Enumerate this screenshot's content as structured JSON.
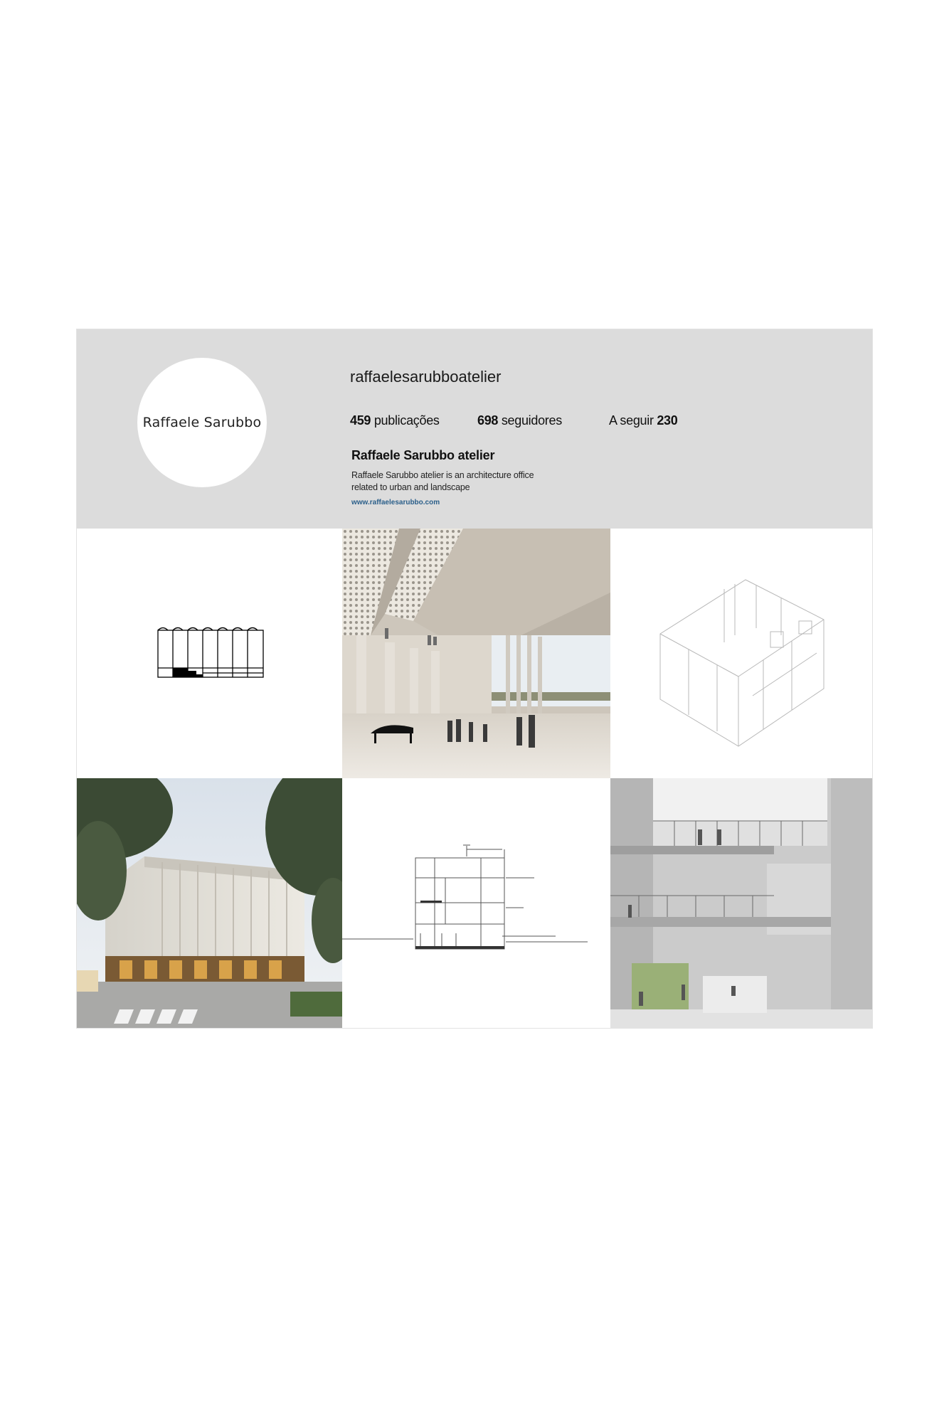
{
  "profile": {
    "avatar_text": "Raffaele Sarubbo",
    "username": "raffaelesarubboatelier",
    "stats": {
      "posts_count": "459",
      "posts_label": "publicações",
      "followers_count": "698",
      "followers_label": "seguidores",
      "following_label": "A seguir",
      "following_count": "230"
    },
    "full_name": "Raffaele Sarubbo atelier",
    "bio": "Raffaele Sarubbo atelier is an architecture office related to urban and landscape",
    "website": "www.raffaelesarubbo.com"
  },
  "colors": {
    "header_bg": "#dcdcdc",
    "link": "#2b5f8a"
  },
  "posts": [
    {
      "subject": "elevation-drawing"
    },
    {
      "subject": "interior-hall-render"
    },
    {
      "subject": "axonometric-drawing"
    },
    {
      "subject": "building-exterior-photo"
    },
    {
      "subject": "section-drawing"
    },
    {
      "subject": "atrium-interior-render"
    }
  ]
}
